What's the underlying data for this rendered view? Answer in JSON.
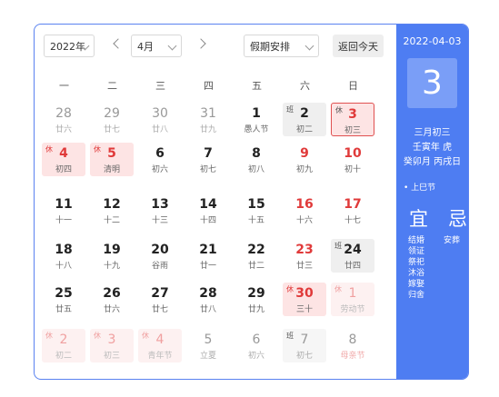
{
  "controls": {
    "year": "2022年",
    "month": "4月",
    "holiday": "假期安排",
    "today": "返回今天"
  },
  "weekdays": [
    "一",
    "二",
    "三",
    "四",
    "五",
    "六",
    "日"
  ],
  "cells": [
    {
      "num": "28",
      "lunar": "廿六",
      "tag": "",
      "type": "other"
    },
    {
      "num": "29",
      "lunar": "廿七",
      "tag": "",
      "type": "other"
    },
    {
      "num": "30",
      "lunar": "廿八",
      "tag": "",
      "type": "other"
    },
    {
      "num": "31",
      "lunar": "廿九",
      "tag": "",
      "type": "other"
    },
    {
      "num": "1",
      "lunar": "愚人节",
      "tag": "",
      "type": "normal"
    },
    {
      "num": "2",
      "lunar": "初二",
      "tag": "班",
      "type": "work"
    },
    {
      "num": "3",
      "lunar": "初三",
      "tag": "休",
      "type": "sel"
    },
    {
      "num": "4",
      "lunar": "初四",
      "tag": "休",
      "type": "hol"
    },
    {
      "num": "5",
      "lunar": "清明",
      "tag": "休",
      "type": "hol"
    },
    {
      "num": "6",
      "lunar": "初六",
      "tag": "",
      "type": "normal"
    },
    {
      "num": "7",
      "lunar": "初七",
      "tag": "",
      "type": "normal"
    },
    {
      "num": "8",
      "lunar": "初八",
      "tag": "",
      "type": "normal"
    },
    {
      "num": "9",
      "lunar": "初九",
      "tag": "",
      "type": "wkd"
    },
    {
      "num": "10",
      "lunar": "初十",
      "tag": "",
      "type": "wkd"
    },
    {
      "num": "11",
      "lunar": "十一",
      "tag": "",
      "type": "normal"
    },
    {
      "num": "12",
      "lunar": "十二",
      "tag": "",
      "type": "normal"
    },
    {
      "num": "13",
      "lunar": "十三",
      "tag": "",
      "type": "normal"
    },
    {
      "num": "14",
      "lunar": "十四",
      "tag": "",
      "type": "normal"
    },
    {
      "num": "15",
      "lunar": "十五",
      "tag": "",
      "type": "normal"
    },
    {
      "num": "16",
      "lunar": "十六",
      "tag": "",
      "type": "wkd"
    },
    {
      "num": "17",
      "lunar": "十七",
      "tag": "",
      "type": "wkd"
    },
    {
      "num": "18",
      "lunar": "十八",
      "tag": "",
      "type": "normal"
    },
    {
      "num": "19",
      "lunar": "十九",
      "tag": "",
      "type": "normal"
    },
    {
      "num": "20",
      "lunar": "谷雨",
      "tag": "",
      "type": "normal"
    },
    {
      "num": "21",
      "lunar": "廿一",
      "tag": "",
      "type": "normal"
    },
    {
      "num": "22",
      "lunar": "廿二",
      "tag": "",
      "type": "normal"
    },
    {
      "num": "23",
      "lunar": "廿三",
      "tag": "",
      "type": "wkd"
    },
    {
      "num": "24",
      "lunar": "廿四",
      "tag": "班",
      "type": "work"
    },
    {
      "num": "25",
      "lunar": "廿五",
      "tag": "",
      "type": "normal"
    },
    {
      "num": "26",
      "lunar": "廿六",
      "tag": "",
      "type": "normal"
    },
    {
      "num": "27",
      "lunar": "廿七",
      "tag": "",
      "type": "normal"
    },
    {
      "num": "28",
      "lunar": "廿八",
      "tag": "",
      "type": "normal"
    },
    {
      "num": "29",
      "lunar": "廿九",
      "tag": "",
      "type": "normal"
    },
    {
      "num": "30",
      "lunar": "三十",
      "tag": "休",
      "type": "hol"
    },
    {
      "num": "1",
      "lunar": "劳动节",
      "tag": "休",
      "type": "hol other festgray"
    },
    {
      "num": "2",
      "lunar": "初二",
      "tag": "休",
      "type": "hol other"
    },
    {
      "num": "3",
      "lunar": "初三",
      "tag": "休",
      "type": "hol other"
    },
    {
      "num": "4",
      "lunar": "青年节",
      "tag": "休",
      "type": "hol other"
    },
    {
      "num": "5",
      "lunar": "立夏",
      "tag": "",
      "type": "other"
    },
    {
      "num": "6",
      "lunar": "初六",
      "tag": "",
      "type": "other"
    },
    {
      "num": "7",
      "lunar": "初七",
      "tag": "班",
      "type": "work other"
    },
    {
      "num": "8",
      "lunar": "母亲节",
      "tag": "",
      "type": "other festgray"
    }
  ],
  "side": {
    "date": "2022-04-03",
    "day": "3",
    "lunar": "三月初三",
    "ganzhi_year": "壬寅年 虎",
    "ganzhi_md": "癸卯月 丙戌日",
    "festival": "• 上巳节",
    "yi_label": "宜",
    "ji_label": "忌",
    "yi": [
      "结婚",
      "领证",
      "祭祀",
      "沐浴",
      "嫁娶",
      "归舍"
    ],
    "ji": [
      "安葬"
    ]
  }
}
